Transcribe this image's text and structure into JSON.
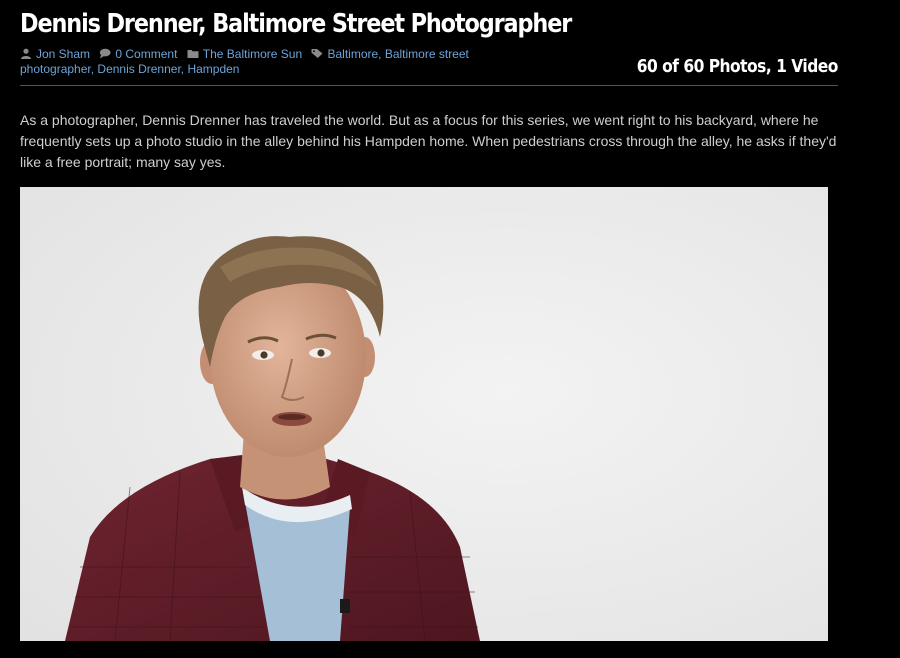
{
  "post": {
    "title": "Dennis Drenner, Baltimore Street Photographer",
    "author": "Jon Sham",
    "comments": "0 Comment",
    "category": "The Baltimore Sun",
    "tags": "Baltimore, Baltimore street photographer, Dennis Drenner, Hampden",
    "media_count": "60 of 60 Photos, 1 Video",
    "description": "As a photographer, Dennis Drenner has traveled the world. But as a focus for this series, we went right to his backyard, where he frequently sets up a photo studio in the alley behind his Hampden home. When pedestrians cross through the alley, he asks if they'd like a free portrait; many say yes."
  },
  "icons": {
    "author": "user-icon",
    "comments": "comment-bubble-icon",
    "category": "folder-icon",
    "tags": "tag-icon"
  },
  "colors": {
    "background": "#000000",
    "link": "#6da4d8",
    "body_text": "#cfcfcf",
    "title": "#ffffff"
  }
}
